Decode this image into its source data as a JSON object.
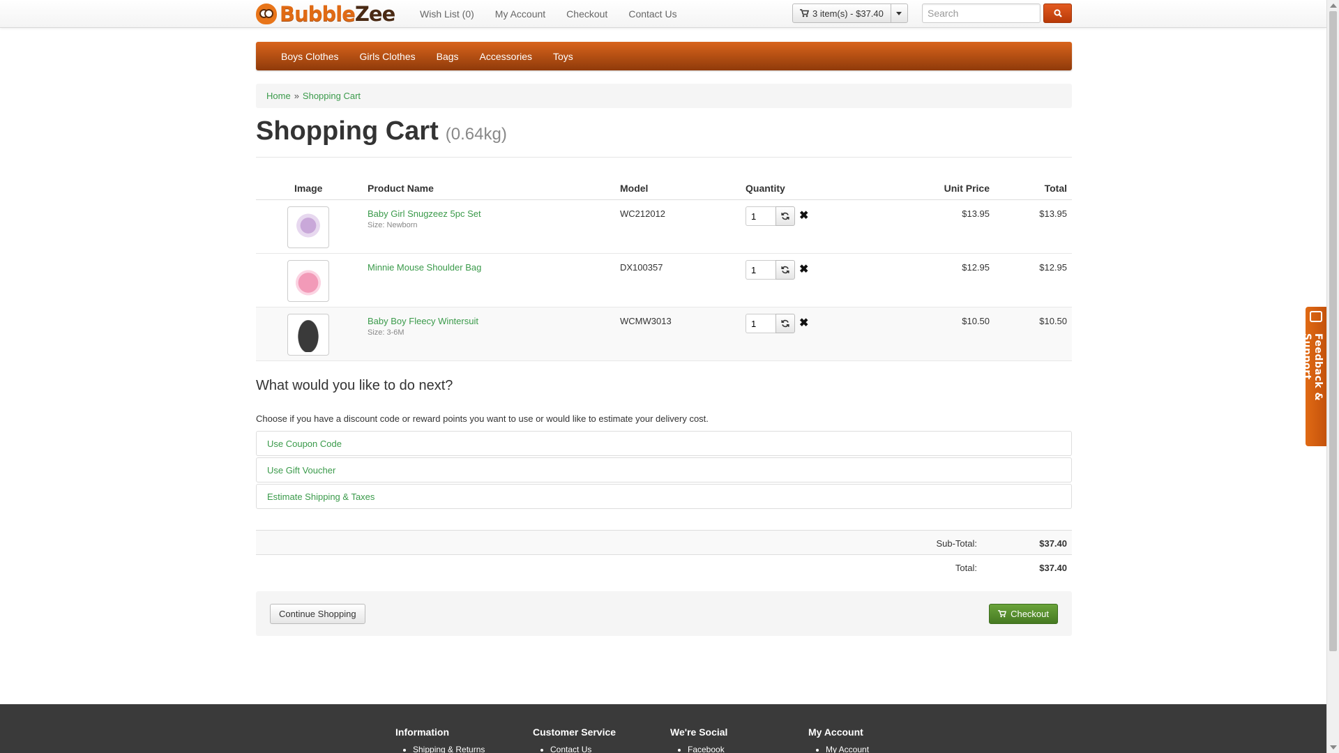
{
  "header": {
    "logo_text_a": "Bubble",
    "logo_text_b": "Zee",
    "nav": [
      "Wish List (0)",
      "My Account",
      "Checkout",
      "Contact Us"
    ],
    "cart_summary": "3 item(s) - $37.40",
    "search_placeholder": "Search"
  },
  "categories": [
    "Boys Clothes",
    "Girls Clothes",
    "Bags",
    "Accessories",
    "Toys"
  ],
  "breadcrumb": {
    "home": "Home",
    "separator": "»",
    "current": "Shopping Cart"
  },
  "page": {
    "title": "Shopping Cart",
    "weight": "(0.64kg)"
  },
  "cart": {
    "columns": {
      "image": "Image",
      "name": "Product Name",
      "model": "Model",
      "quantity": "Quantity",
      "unit_price": "Unit Price",
      "total": "Total"
    },
    "items": [
      {
        "name": "Baby Girl Snugzeez 5pc Set",
        "option": "Size: Newborn",
        "model": "WC212012",
        "quantity": "1",
        "unit_price": "$13.95",
        "total": "$13.95",
        "thumb_color": "#c9a8d9"
      },
      {
        "name": "Minnie Mouse Shoulder Bag",
        "option": "",
        "model": "DX100357",
        "quantity": "1",
        "unit_price": "$12.95",
        "total": "$12.95",
        "thumb_color": "#f29ab8"
      },
      {
        "name": "Baby Boy Fleecy Wintersuit",
        "option": "Size: 3-6M",
        "model": "WCMW3013",
        "quantity": "1",
        "unit_price": "$10.50",
        "total": "$10.50",
        "thumb_color": "#3a3a3a"
      }
    ]
  },
  "next": {
    "title": "What would you like to do next?",
    "description": "Choose if you have a discount code or reward points you want to use or would like to estimate your delivery cost.",
    "options": [
      "Use Coupon Code",
      "Use Gift Voucher",
      "Estimate Shipping & Taxes"
    ]
  },
  "totals": [
    {
      "label": "Sub-Total:",
      "value": "$37.40"
    },
    {
      "label": "Total:",
      "value": "$37.40"
    }
  ],
  "buttons": {
    "continue": "Continue Shopping",
    "checkout": "Checkout"
  },
  "footer": {
    "columns": [
      {
        "heading": "Information",
        "first_link": "Shipping & Returns"
      },
      {
        "heading": "Customer Service",
        "first_link": "Contact Us"
      },
      {
        "heading": "We're Social",
        "first_link": "Facebook"
      },
      {
        "heading": "My Account",
        "first_link": "My Account"
      }
    ]
  },
  "feedback_tab": "Feedback & Support",
  "colors": {
    "link": "#3a9a4a",
    "brand_orange": "#d9641c",
    "checkout_green": "#5a8f2e",
    "footer_bg": "#3a3a3a"
  },
  "icons": [
    "cart-icon",
    "caret-down-icon",
    "search-icon",
    "refresh-icon",
    "remove-icon",
    "feedback-icon"
  ]
}
